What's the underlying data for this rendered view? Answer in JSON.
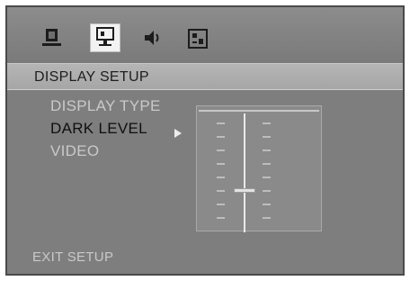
{
  "toolbar": {
    "icons": [
      "general-setup-icon",
      "display-setup-icon",
      "audio-setup-icon",
      "preferences-icon"
    ],
    "active_icon": "display-setup-icon"
  },
  "header": {
    "title": "DISPLAY SETUP"
  },
  "menu": {
    "items": [
      {
        "label": "DISPLAY TYPE",
        "state": "dim"
      },
      {
        "label": "DARK LEVEL",
        "state": "selected"
      },
      {
        "label": "VIDEO",
        "state": "dim"
      }
    ]
  },
  "dark_level": {
    "scale_labels": [
      "",
      "",
      "",
      "",
      "",
      "",
      "",
      ""
    ],
    "current_index": 5
  },
  "footer": {
    "exit_label": "EXIT SETUP"
  },
  "colors": {
    "background": "#7e7e7e",
    "header": "#aeaeae",
    "selected_text": "#0f0f0f",
    "dim_text": "#c9c9c9"
  }
}
